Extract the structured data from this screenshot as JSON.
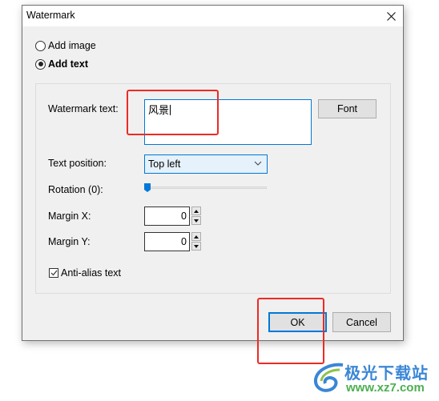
{
  "window": {
    "title": "Watermark",
    "close_icon": "close-icon"
  },
  "mode": {
    "options": [
      {
        "label": "Add image",
        "checked": false
      },
      {
        "label": "Add text",
        "checked": true
      }
    ]
  },
  "form": {
    "watermark_text_label": "Watermark text:",
    "watermark_text_value": "风景",
    "font_button": "Font",
    "text_position_label": "Text position:",
    "text_position_value": "Top left",
    "rotation_label": "Rotation (0):",
    "rotation_value": 0,
    "margin_x_label": "Margin X:",
    "margin_x_value": "0",
    "margin_y_label": "Margin Y:",
    "margin_y_value": "0",
    "antialias_label": "Anti-alias text",
    "antialias_checked": true
  },
  "buttons": {
    "ok": "OK",
    "cancel": "Cancel"
  },
  "colors": {
    "accent": "#0078d7",
    "annotation": "#ee2a24"
  },
  "branding": {
    "site_name": "极光下载站",
    "site_url": "www.xz7.com"
  }
}
